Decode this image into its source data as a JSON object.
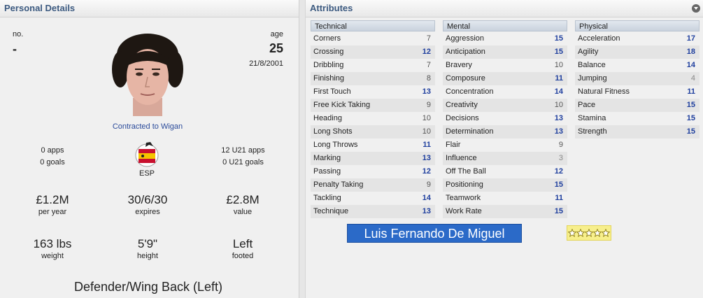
{
  "personal": {
    "header": "Personal Details",
    "no_label": "no.",
    "no_value": "-",
    "age_label": "age",
    "age_value": "25",
    "dob": "21/8/2001",
    "contract": "Contracted to Wigan",
    "apps": "0 apps",
    "goals": "0 goals",
    "nation": "ESP",
    "u21_apps": "12 U21 apps",
    "u21_goals": "0 U21 goals",
    "wage": "£1.2M",
    "wage_label": "per year",
    "expires": "30/6/30",
    "expires_label": "expires",
    "value": "£2.8M",
    "value_label": "value",
    "weight": "163 lbs",
    "weight_label": "weight",
    "height": "5'9\"",
    "height_label": "height",
    "foot": "Left",
    "foot_label": "footed",
    "position": "Defender/Wing Back (Left)"
  },
  "attributes": {
    "header": "Attributes",
    "technical_header": "Technical",
    "mental_header": "Mental",
    "physical_header": "Physical",
    "technical": [
      {
        "name": "Corners",
        "value": "7"
      },
      {
        "name": "Crossing",
        "value": "12"
      },
      {
        "name": "Dribbling",
        "value": "7"
      },
      {
        "name": "Finishing",
        "value": "8"
      },
      {
        "name": "First Touch",
        "value": "13"
      },
      {
        "name": "Free Kick Taking",
        "value": "9"
      },
      {
        "name": "Heading",
        "value": "10"
      },
      {
        "name": "Long Shots",
        "value": "10"
      },
      {
        "name": "Long Throws",
        "value": "11"
      },
      {
        "name": "Marking",
        "value": "13"
      },
      {
        "name": "Passing",
        "value": "12"
      },
      {
        "name": "Penalty Taking",
        "value": "9"
      },
      {
        "name": "Tackling",
        "value": "14"
      },
      {
        "name": "Technique",
        "value": "13"
      }
    ],
    "mental": [
      {
        "name": "Aggression",
        "value": "15"
      },
      {
        "name": "Anticipation",
        "value": "15"
      },
      {
        "name": "Bravery",
        "value": "10"
      },
      {
        "name": "Composure",
        "value": "11"
      },
      {
        "name": "Concentration",
        "value": "14"
      },
      {
        "name": "Creativity",
        "value": "10"
      },
      {
        "name": "Decisions",
        "value": "13"
      },
      {
        "name": "Determination",
        "value": "13"
      },
      {
        "name": "Flair",
        "value": "9"
      },
      {
        "name": "Influence",
        "value": "3"
      },
      {
        "name": "Off The Ball",
        "value": "12"
      },
      {
        "name": "Positioning",
        "value": "15"
      },
      {
        "name": "Teamwork",
        "value": "11"
      },
      {
        "name": "Work Rate",
        "value": "15"
      }
    ],
    "physical": [
      {
        "name": "Acceleration",
        "value": "17"
      },
      {
        "name": "Agility",
        "value": "18"
      },
      {
        "name": "Balance",
        "value": "14"
      },
      {
        "name": "Jumping",
        "value": "4"
      },
      {
        "name": "Natural Fitness",
        "value": "11"
      },
      {
        "name": "Pace",
        "value": "15"
      },
      {
        "name": "Stamina",
        "value": "15"
      },
      {
        "name": "Strength",
        "value": "15"
      }
    ]
  },
  "player_name": "Luis Fernando De Miguel",
  "star_rating": 5,
  "colors": {
    "accent": "#3c5a80",
    "banner": "#2b6ac8",
    "attr_high": "#1f3f9e",
    "stars_bg": "#f7ef8c"
  }
}
